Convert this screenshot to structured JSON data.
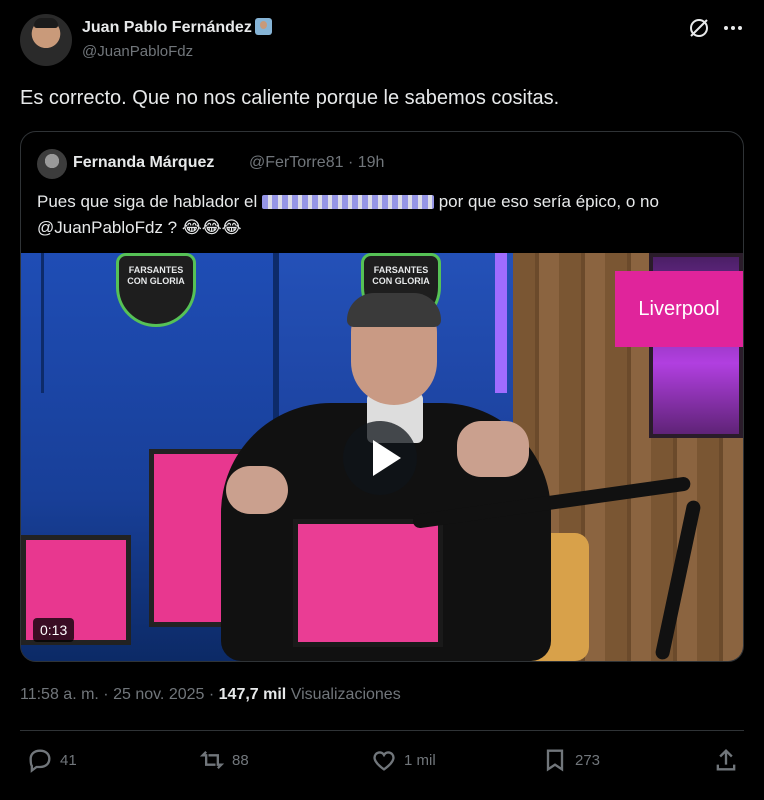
{
  "author": {
    "name": "Juan Pablo Fernández",
    "handle": "@JuanPabloFdz"
  },
  "post": {
    "text": "Es correcto. Que no nos caliente porque le sabemos cositas."
  },
  "quote": {
    "name": "Fernanda Márquez",
    "handle_time": "@FerTorre81 · 19h",
    "text_before": "Pues que siga de hablador el",
    "text_after": "por que eso sería épico, o no",
    "line2": "@JuanPabloFdz ? 😂😂😂",
    "video": {
      "timecode": "0:13",
      "brand": "Liverpool",
      "logo_text": "FARSANTES CON GLORIA"
    }
  },
  "meta": {
    "time": "11:58 a. m. · 25 nov. 2025 · ",
    "views_count": "147,7 mil",
    "views_label": " Visualizaciones"
  },
  "actions": {
    "replies": "41",
    "reposts": "88",
    "likes": "1 mil",
    "bookmarks": "273"
  },
  "icons": [
    "grok-icon",
    "more-icon",
    "reply-icon",
    "repost-icon",
    "like-icon",
    "bookmark-icon",
    "share-icon"
  ]
}
